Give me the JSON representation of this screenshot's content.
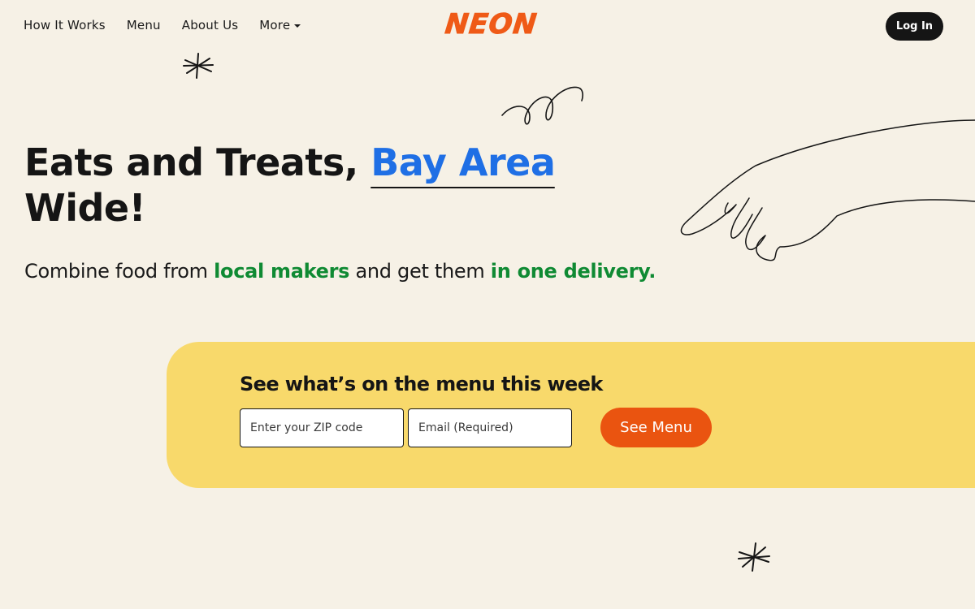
{
  "nav": {
    "links": [
      "How It Works",
      "Menu",
      "About Us"
    ],
    "more_label": "More",
    "logo": "NEON",
    "login_label": "Log In"
  },
  "hero": {
    "title_part1": "Eats and Treats, ",
    "title_accent": "Bay Area",
    "title_part2": "Wide!",
    "sub_part1": "Combine food from ",
    "sub_green1": "local makers",
    "sub_part2": " and get them ",
    "sub_green2": "in one delivery."
  },
  "cta": {
    "heading": "See what’s on the menu this week",
    "zip_placeholder": "Enter your ZIP code",
    "email_placeholder": "Email (Required)",
    "button_label": "See Menu"
  },
  "colors": {
    "background": "#f6f1e6",
    "brand_orange": "#ef5a17",
    "accent_blue": "#1f6fe5",
    "accent_green": "#0f8a33",
    "panel_yellow": "#f8d96b",
    "dark": "#151515"
  }
}
